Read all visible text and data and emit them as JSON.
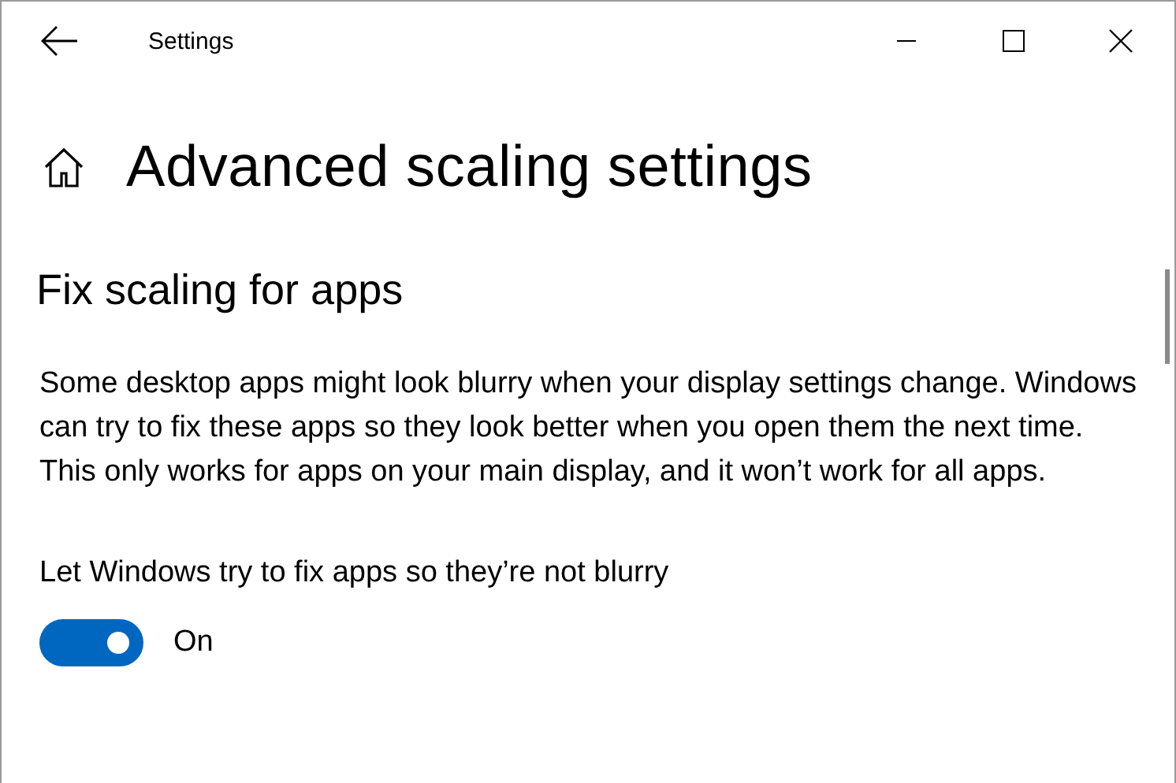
{
  "window": {
    "title": "Settings"
  },
  "page_title": "Advanced scaling settings",
  "section": {
    "title": "Fix scaling for apps",
    "description": "Some desktop apps might look blurry when your display settings change. Windows can try to fix these apps so they look better when you open them the next time. This only works for apps on your main display, and it won’t work for all apps.",
    "toggle": {
      "label": "Let Windows try to fix apps so they’re not blurry",
      "on": true,
      "state_label": "On"
    }
  }
}
